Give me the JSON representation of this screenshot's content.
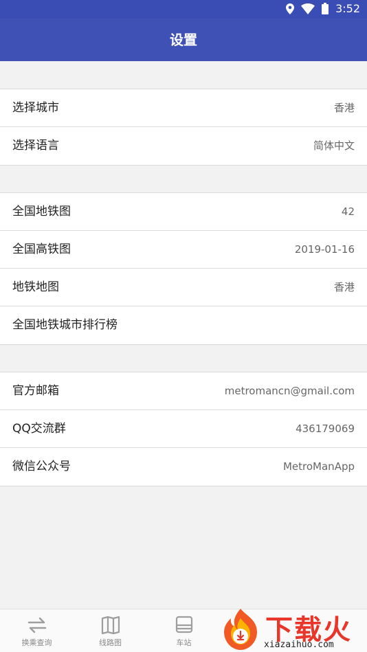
{
  "status_bar": {
    "time": "3:52",
    "icons": [
      "location-icon",
      "wifi-icon",
      "battery-icon"
    ]
  },
  "app_bar": {
    "title": "设置"
  },
  "groups": [
    {
      "rows": [
        {
          "label": "选择城市",
          "value": "香港"
        },
        {
          "label": "选择语言",
          "value": "简体中文"
        }
      ]
    },
    {
      "rows": [
        {
          "label": "全国地铁图",
          "value": "42"
        },
        {
          "label": "全国高铁图",
          "value": "2019-01-16"
        },
        {
          "label": "地铁地图",
          "value": "香港"
        },
        {
          "label": "全国地铁城市排行榜",
          "value": ""
        }
      ]
    },
    {
      "rows": [
        {
          "label": "官方邮箱",
          "value": "metromancn@gmail.com"
        },
        {
          "label": "QQ交流群",
          "value": "436179069"
        },
        {
          "label": "微信公众号",
          "value": "MetroManApp"
        }
      ]
    }
  ],
  "bottom_nav": [
    {
      "label": "换乘查询",
      "icon": "transfer-icon"
    },
    {
      "label": "线路图",
      "icon": "map-icon"
    },
    {
      "label": "车站",
      "icon": "station-icon"
    }
  ],
  "watermark": {
    "text": "下载火",
    "url": "xiazaihuo.com"
  },
  "colors": {
    "primary": "#3f51b5",
    "status_bar": "#3a4db5",
    "background": "#f2f2f2",
    "watermark": "#e8372a"
  }
}
